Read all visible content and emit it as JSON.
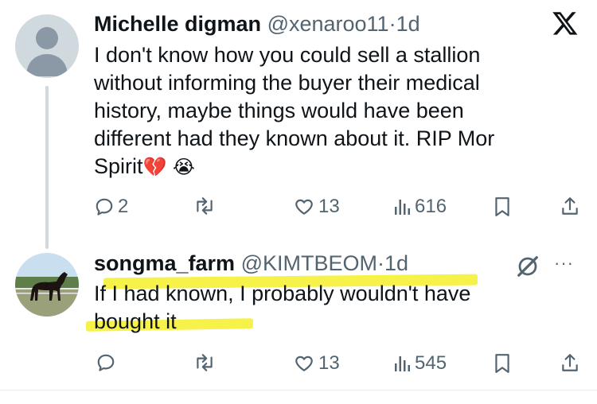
{
  "x_logo": "X",
  "tweet1": {
    "author_name": "Michelle digman",
    "handle": "@xenaroo11",
    "separator": "·",
    "time": "1d",
    "lines": [
      "I don't know how you could sell a stallion",
      "without informing the buyer their medical",
      "history, maybe things would have been",
      "different had they known about it. RIP Mor",
      "Spirit"
    ],
    "emoji_1": "💔",
    "emoji_2": "😭",
    "replies": "2",
    "likes": "13",
    "views": "616"
  },
  "tweet2": {
    "author_name": "songma_farm",
    "handle": "@KIMTBEOM",
    "separator": "·",
    "time": "1d",
    "more": "···",
    "lines": [
      "If I had known, I probably wouldn't have",
      "bought it"
    ],
    "likes": "13",
    "views": "545"
  },
  "colors": {
    "text": "#0f1419",
    "secondary": "#536471",
    "highlight": "#f6f24a",
    "thread_line": "#cfd9de"
  }
}
